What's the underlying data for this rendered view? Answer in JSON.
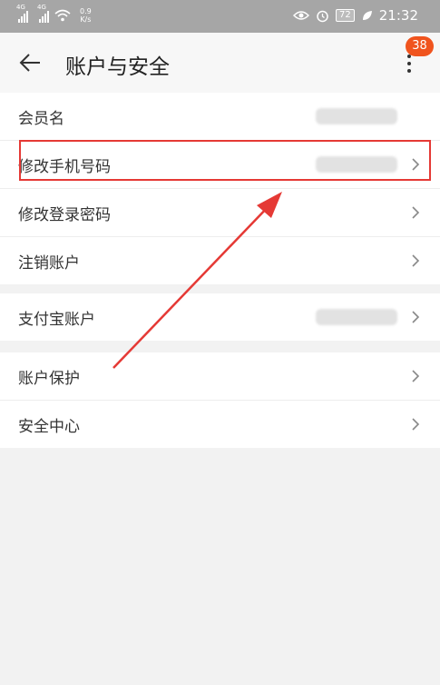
{
  "status_bar": {
    "signal1_tag": "4G",
    "signal2_tag": "4G",
    "net_speed_value": "0.9",
    "net_speed_unit": "K/s",
    "battery": "72",
    "time": "21:32"
  },
  "header": {
    "title": "账户与安全",
    "notification_count": "38"
  },
  "groups": [
    {
      "rows": [
        {
          "label": "会员名",
          "value_redacted": true,
          "chevron": false
        },
        {
          "label": "修改手机号码",
          "value_redacted": true,
          "chevron": true,
          "highlighted": true
        },
        {
          "label": "修改登录密码",
          "chevron": true
        },
        {
          "label": "注销账户",
          "chevron": true
        }
      ]
    },
    {
      "rows": [
        {
          "label": "支付宝账户",
          "value_redacted": true,
          "chevron": true
        }
      ]
    },
    {
      "rows": [
        {
          "label": "账户保护",
          "chevron": true
        },
        {
          "label": "安全中心",
          "chevron": true
        }
      ]
    }
  ],
  "annotation": {
    "highlight_color": "#e53935",
    "arrow_color": "#e53935"
  },
  "icons": [
    "back-arrow-icon",
    "more-vertical-icon",
    "chevron-right-icon",
    "eye-icon",
    "alarm-icon",
    "wifi-icon",
    "signal-icon",
    "leaf-icon"
  ]
}
